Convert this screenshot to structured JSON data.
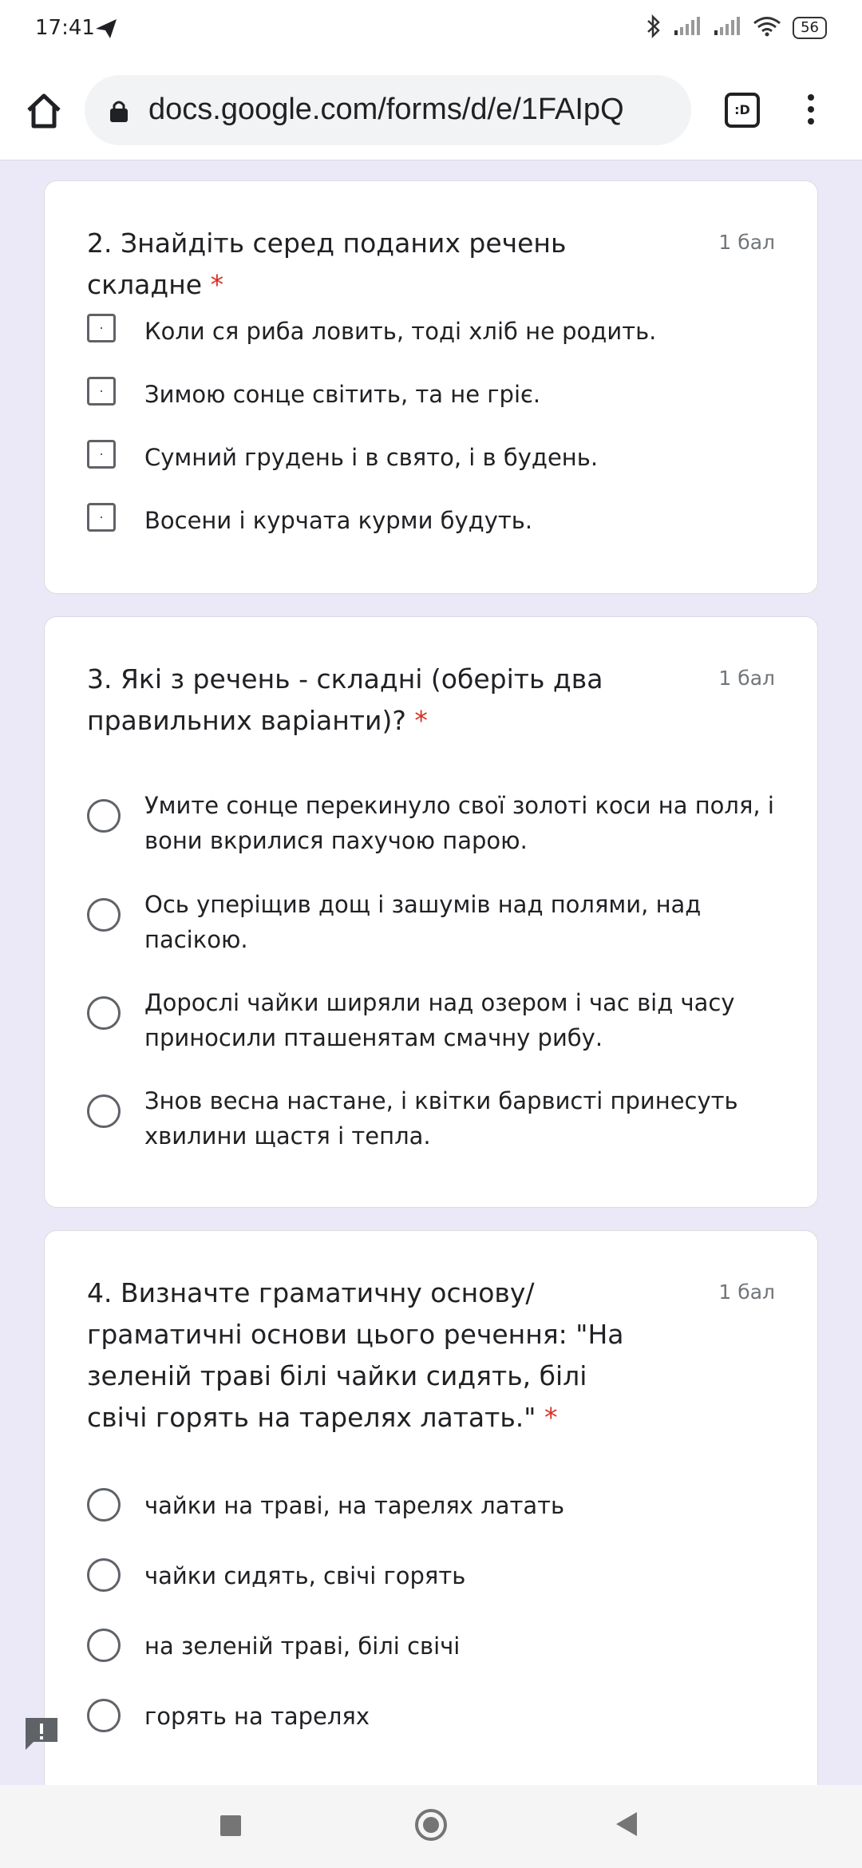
{
  "status_bar": {
    "time": "17:41",
    "battery": "56"
  },
  "browser": {
    "url": "docs.google.com/forms/d/e/1FAIpQ",
    "tab_switcher_label": ":D"
  },
  "questions": [
    {
      "title": "2. Знайдіть серед поданих речень складне",
      "required_mark": "*",
      "points": "1 бал",
      "type": "checkbox",
      "options": [
        "Коли ся риба ловить, тоді хліб не родить.",
        "Зимою сонце світить, та не гріє.",
        "Сумний грудень і в свято, і в будень.",
        "Восени і курчата курми будуть."
      ]
    },
    {
      "title": "3. Які з речень - складні (оберіть два правильних варіанти)?",
      "required_mark": "*",
      "points": "1 бал",
      "type": "radio",
      "options": [
        "Умите сонце перекинуло свої золоті коси на поля, і вони вкрилися пахучою парою.",
        "Ось уперіщив дощ і зашумів над полями, над пасікою.",
        "Дорослі чайки ширяли над озером і час від часу приносили пташенятам смачну рибу.",
        "Знов весна настане, і квітки барвисті принесуть хвилини щастя і тепла."
      ]
    },
    {
      "title": "4. Визначте граматичну основу/граматичні основи цього речення: \"На зеленій траві білі чайки сидять, білі свічі горять на тарелях латать.\"",
      "required_mark": "*",
      "points": "1 бал",
      "type": "radio",
      "options": [
        "чайки на траві, на тарелях латать",
        "чайки сидять, свічі горять",
        "на зеленій траві, білі свічі",
        "горять на тарелях"
      ]
    }
  ],
  "colors": {
    "form_background": "#ebe9f7",
    "required": "#d93025",
    "control_border": "#5f6368"
  },
  "icons": [
    "send-icon",
    "bluetooth-icon",
    "signal-icon",
    "wifi-icon",
    "home-icon",
    "lock-icon",
    "menu-icon",
    "feedback-icon",
    "nav-recents-icon",
    "nav-home-icon",
    "nav-back-icon"
  ]
}
